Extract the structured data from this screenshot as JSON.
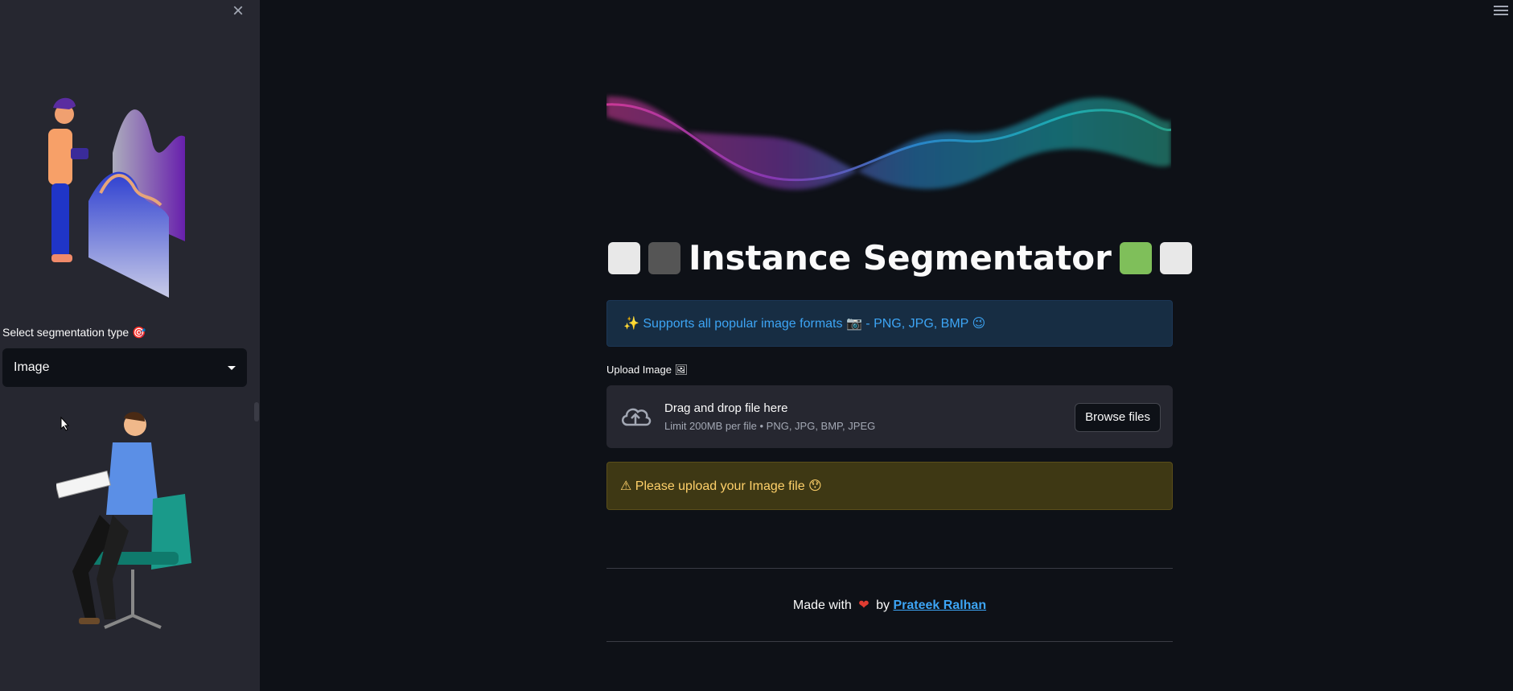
{
  "sidebar": {
    "select_label": "Select segmentation type",
    "select_label_emoji": "🎯",
    "select_value": "Image"
  },
  "main": {
    "title": "Instance Segmentator",
    "info_text": "✨ Supports all popular image formats 📷 - PNG, JPG, BMP 😉",
    "upload_label": "Upload Image 🖼",
    "dropzone_title": "Drag and drop file here",
    "dropzone_limit": "Limit 200MB per file • PNG, JPG, BMP, JPEG",
    "browse_label": "Browse files",
    "warning_text": "⚠ Please upload your Image file 😯",
    "footer_made_with": "Made with",
    "footer_heart": "❤",
    "footer_by": "by",
    "footer_author": "Prateek Ralhan"
  },
  "colors": {
    "background": "#0e1117",
    "sidebar": "#262730",
    "info_text": "#3da5f5",
    "warning_text": "#ffd16a"
  }
}
